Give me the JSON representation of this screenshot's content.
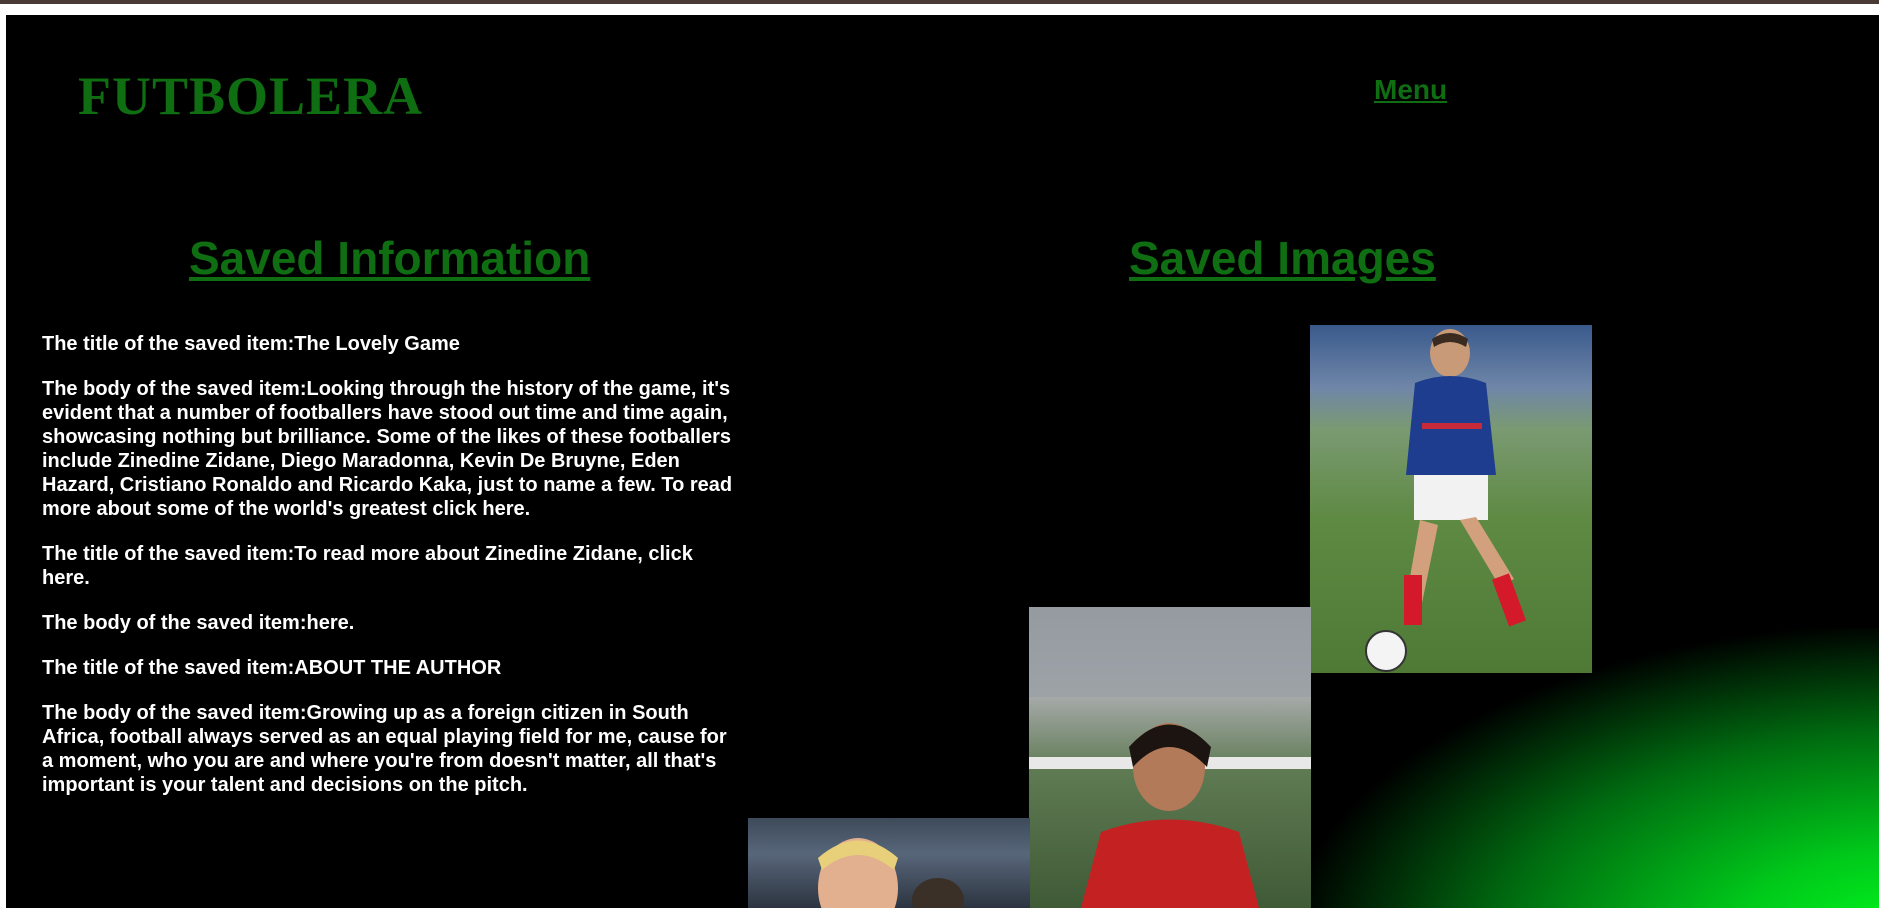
{
  "brand": {
    "logo_text": "FUTBOLERA"
  },
  "nav": {
    "menu_label": "Menu"
  },
  "sections": {
    "info_title": "Saved Information",
    "images_title": "Saved Images"
  },
  "saved_items": [
    {
      "text": "The title of the saved item:The Lovely Game"
    },
    {
      "text": "The body of the saved item:Looking through the history of the game, it's evident that a number of footballers have stood out time and time again, showcasing nothing but brilliance. Some of the likes of these footballers include Zinedine Zidane, Diego Maradonna, Kevin De Bruyne, Eden Hazard, Cristiano Ronaldo and Ricardo Kaka, just to name a few. To read more about some of the world's greatest click here."
    },
    {
      "text": "The title of the saved item:To read more about Zinedine Zidane, click here."
    },
    {
      "text": "The body of the saved item:here."
    },
    {
      "text": "The title of the saved item:ABOUT THE AUTHOR"
    },
    {
      "text": "The body of the saved item:Growing up as a foreign citizen in South Africa, football always served as an equal playing field for me, cause for a moment, who you are and where you're from doesn't matter, all that's important is your talent and decisions on the pitch."
    }
  ],
  "colors": {
    "background": "#000000",
    "accent_green": "#0f6d12",
    "text": "#ffffff",
    "glow": "#00ff1e"
  }
}
